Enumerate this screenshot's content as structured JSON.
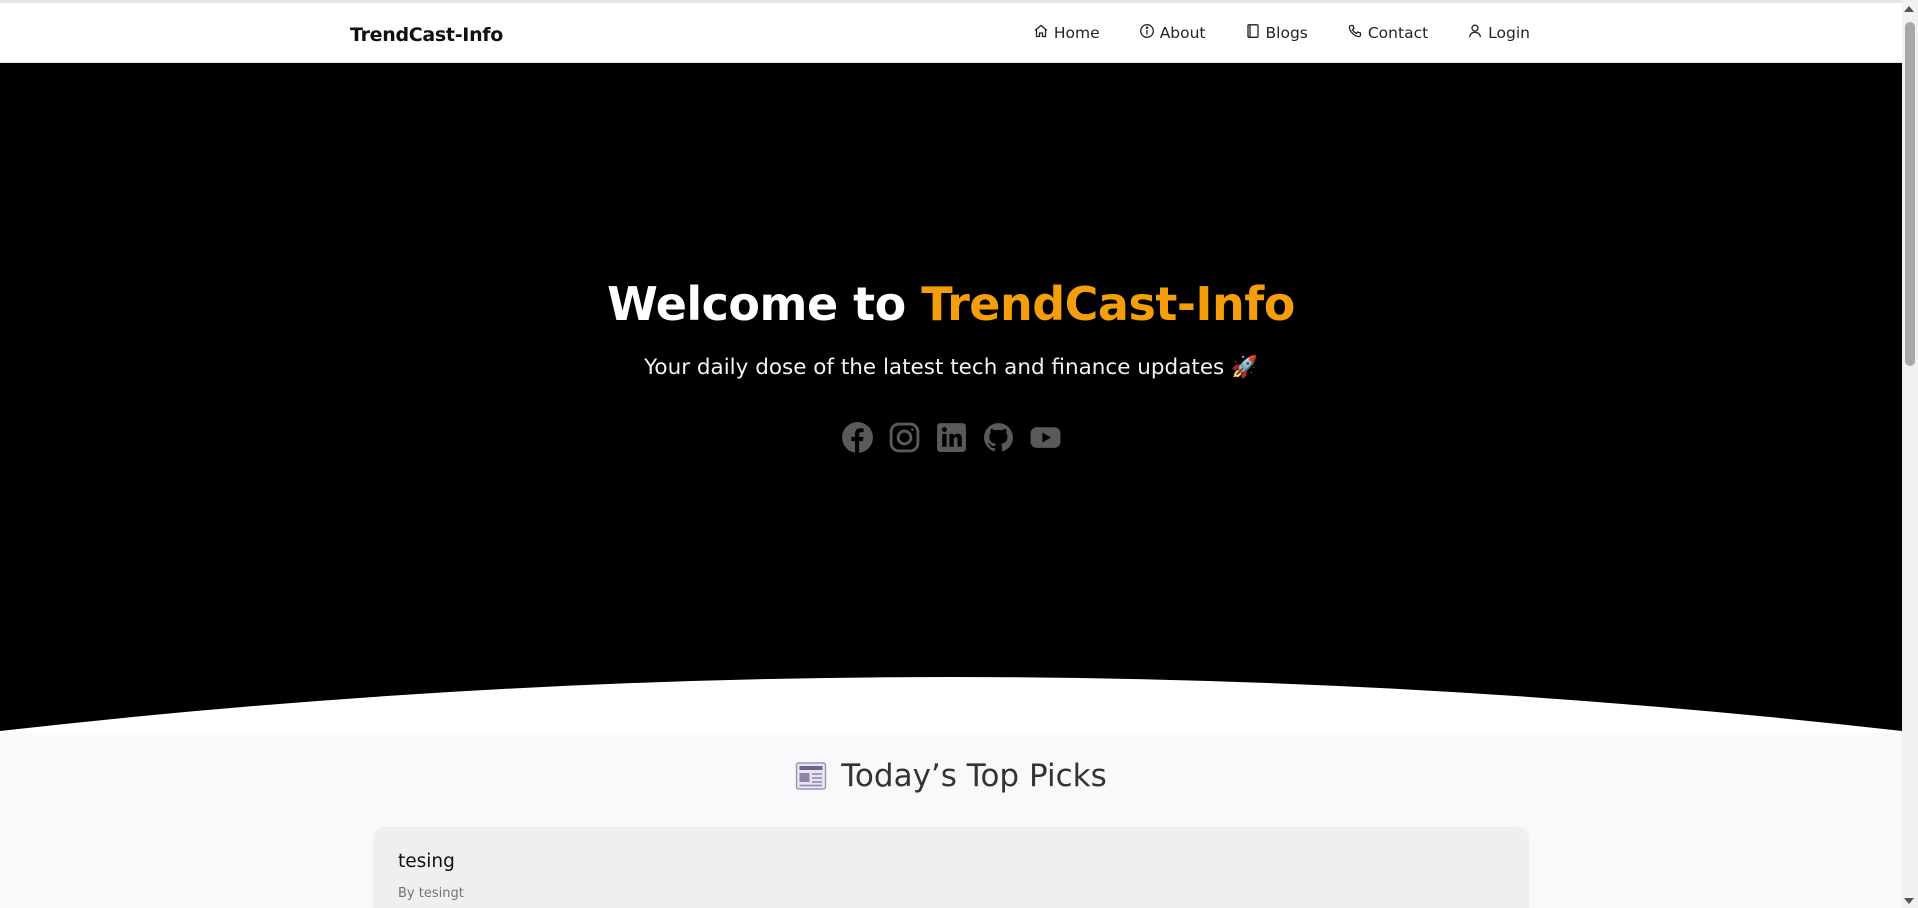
{
  "navbar": {
    "brand": "TrendCast-Info",
    "links": [
      {
        "label": "Home",
        "icon": "home-icon"
      },
      {
        "label": "About",
        "icon": "info-icon"
      },
      {
        "label": "Blogs",
        "icon": "book-icon"
      },
      {
        "label": "Contact",
        "icon": "phone-icon"
      },
      {
        "label": "Login",
        "icon": "user-icon"
      }
    ]
  },
  "hero": {
    "title_prefix": "Welcome to ",
    "title_accent": "TrendCast-Info",
    "subtitle": "Your daily dose of the latest tech and finance updates 🚀",
    "accent_color": "#f59e0b",
    "socials": [
      "facebook-icon",
      "instagram-icon",
      "linkedin-icon",
      "github-icon",
      "youtube-icon"
    ]
  },
  "picks": {
    "heading": "Today’s Top Picks",
    "heading_icon": "newspaper-icon",
    "cards": [
      {
        "title": "tesing",
        "author": "By tesingt"
      }
    ]
  }
}
